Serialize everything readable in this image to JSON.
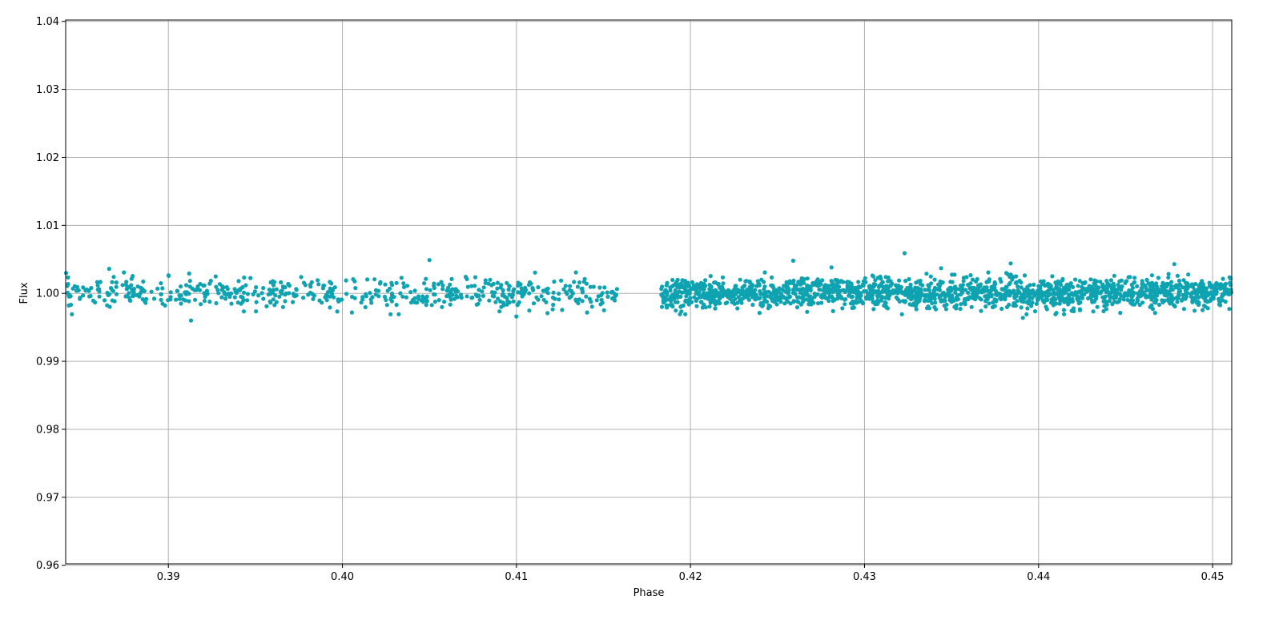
{
  "chart_data": {
    "type": "scatter",
    "title": "",
    "xlabel": "Phase",
    "ylabel": "Flux",
    "xlim": [
      0.3841,
      0.4511
    ],
    "ylim": [
      0.9602,
      1.0402
    ],
    "xticks": [
      0.39,
      0.4,
      0.41,
      0.42,
      0.43,
      0.44,
      0.45
    ],
    "xtick_labels": [
      "0.39",
      "0.40",
      "0.41",
      "0.42",
      "0.43",
      "0.44",
      "0.45"
    ],
    "yticks": [
      0.96,
      0.97,
      0.98,
      0.99,
      1.0,
      1.01,
      1.02,
      1.03,
      1.04
    ],
    "ytick_labels": [
      "0.96",
      "0.97",
      "0.98",
      "0.99",
      "1.00",
      "1.01",
      "1.02",
      "1.03",
      "1.04"
    ],
    "grid": true,
    "marker_color": "#0fa3b1",
    "series": [
      {
        "segments": [
          {
            "x_start": 0.3841,
            "x_end": 0.4158,
            "count": 560,
            "center": 1.0,
            "spread": 0.0011
          },
          {
            "x_start": 0.4183,
            "x_end": 0.4511,
            "count": 1750,
            "center": 1.0,
            "spread": 0.0011
          }
        ],
        "outliers": [
          {
            "x": 0.405,
            "y": 1.0049
          },
          {
            "x": 0.4259,
            "y": 1.0048
          },
          {
            "x": 0.4323,
            "y": 1.0059
          },
          {
            "x": 0.4384,
            "y": 1.0044
          },
          {
            "x": 0.4478,
            "y": 1.0043
          },
          {
            "x": 0.3866,
            "y": 1.0036
          },
          {
            "x": 0.3913,
            "y": 0.996
          },
          {
            "x": 0.41,
            "y": 0.9966
          },
          {
            "x": 0.4391,
            "y": 0.9964
          },
          {
            "x": 0.4344,
            "y": 1.0037
          },
          {
            "x": 0.4281,
            "y": 1.0038
          }
        ]
      }
    ]
  }
}
